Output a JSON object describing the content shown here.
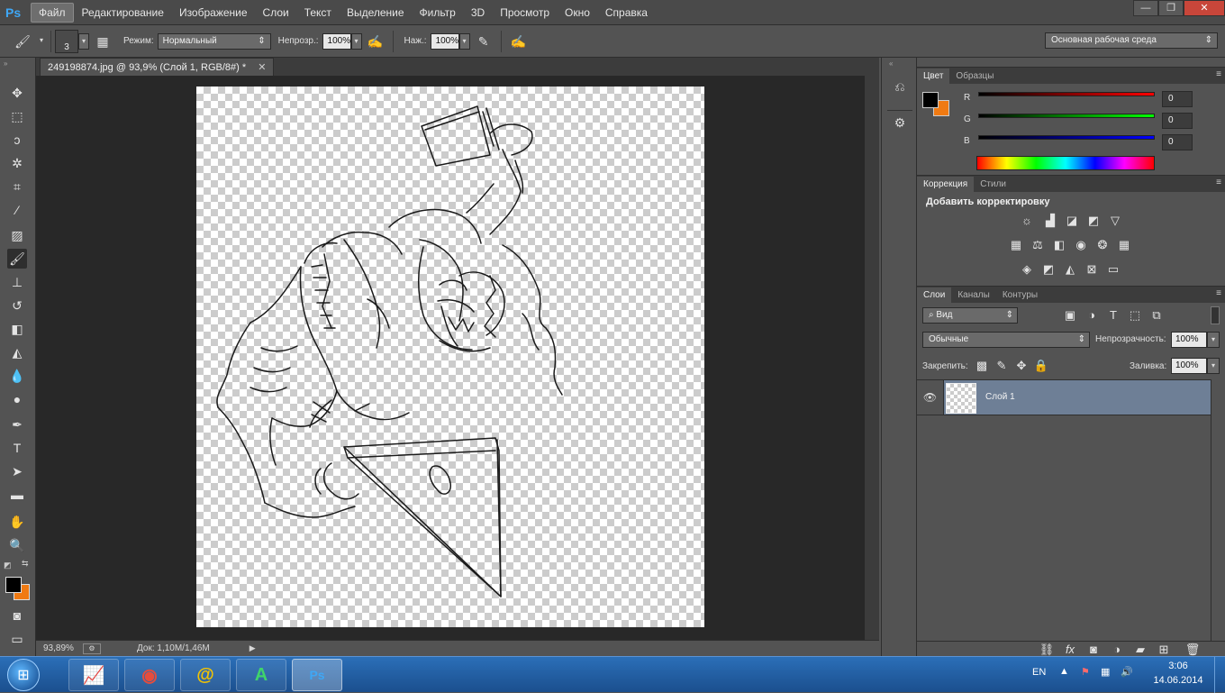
{
  "app": {
    "logo": "Ps"
  },
  "menu": [
    "Файл",
    "Редактирование",
    "Изображение",
    "Слои",
    "Текст",
    "Выделение",
    "Фильтр",
    "3D",
    "Просмотр",
    "Окно",
    "Справка"
  ],
  "options": {
    "brush_size": "3",
    "mode_label": "Режим:",
    "mode_value": "Нормальный",
    "opacity_label": "Непрозр.:",
    "opacity_value": "100%",
    "flow_label": "Наж.:",
    "flow_value": "100%",
    "workspace": "Основная рабочая среда"
  },
  "document": {
    "tab_title": "249198874.jpg @ 93,9% (Слой 1, RGB/8#) *",
    "zoom": "93,89%",
    "doc_info": "Док: 1,10M/1,46M"
  },
  "color_panel": {
    "tabs": [
      "Цвет",
      "Образцы"
    ],
    "channels": [
      {
        "label": "R",
        "value": "0"
      },
      {
        "label": "G",
        "value": "0"
      },
      {
        "label": "B",
        "value": "0"
      }
    ],
    "fg_color": "#000000",
    "bg_color": "#f07a12"
  },
  "adjust_panel": {
    "tabs": [
      "Коррекция",
      "Стили"
    ],
    "heading": "Добавить корректировку"
  },
  "layers_panel": {
    "tabs": [
      "Слои",
      "Каналы",
      "Контуры"
    ],
    "filter_value": "Вид",
    "blend_mode": "Обычные",
    "opacity_label": "Непрозрачность:",
    "opacity_value": "100%",
    "lock_label": "Закрепить:",
    "fill_label": "Заливка:",
    "fill_value": "100%",
    "layers": [
      {
        "name": "Слой 1"
      }
    ]
  },
  "taskbar": {
    "apps": [
      "chart-icon",
      "chrome-icon",
      "mail-icon",
      "a-icon",
      "Ps"
    ],
    "lang": "EN",
    "time": "3:06",
    "date": "14.06.2014"
  }
}
